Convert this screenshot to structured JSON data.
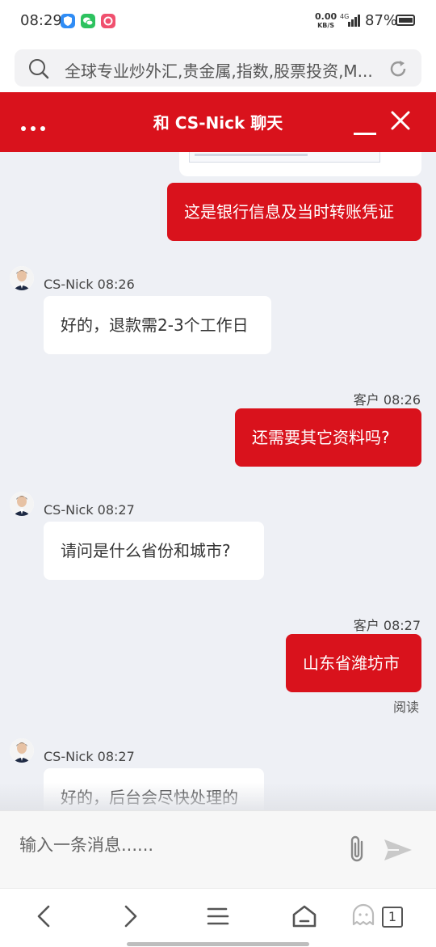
{
  "status_bar": {
    "time": "08:29",
    "net_speed_value": "0.00",
    "net_speed_unit": "KB/S",
    "network_type": "4G",
    "battery": "87%"
  },
  "url_bar": {
    "text": "全球专业炒外汇,贵金属,指数,股票投资,M..."
  },
  "chat": {
    "title": "和 CS-Nick 聊天",
    "messages": [
      {
        "direction": "out",
        "text": "这是银行信息及当时转账凭证"
      },
      {
        "direction": "in",
        "sender": "CS-Nick 08:26",
        "text": "好的，退款需2-3个工作日"
      },
      {
        "direction": "out",
        "meta": "客户 08:26",
        "text": "还需要其它资料吗?"
      },
      {
        "direction": "in",
        "sender": "CS-Nick 08:27",
        "text": "请问是什么省份和城市?"
      },
      {
        "direction": "out",
        "meta": "客户 08:27",
        "text": "山东省潍坊市",
        "status": "阅读"
      },
      {
        "direction": "in",
        "sender": "CS-Nick 08:27",
        "text": "好的，后台会尽快处理的"
      }
    ]
  },
  "composer": {
    "placeholder": "输入一条消息......"
  },
  "nav": {
    "tab_count": "1"
  },
  "colors": {
    "accent": "#d9121c",
    "chat_background": "#eef0f5"
  }
}
